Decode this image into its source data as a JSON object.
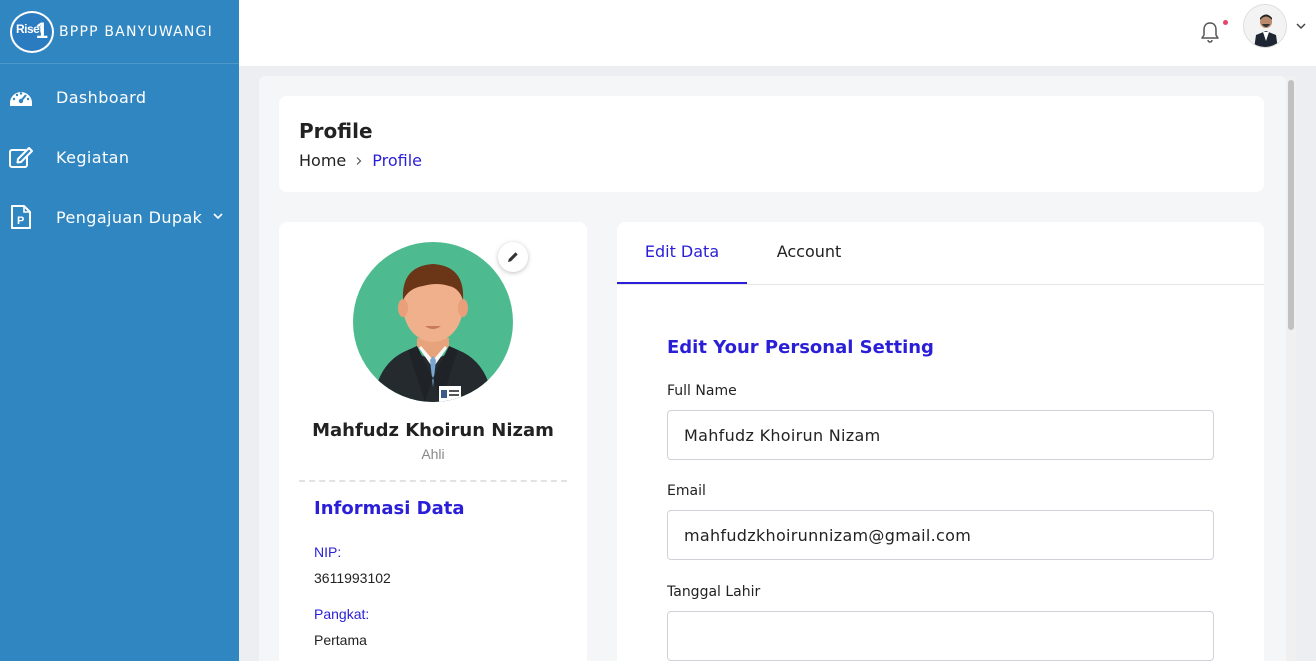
{
  "brand": {
    "name": "BPPP BANYUWANGI",
    "logo_text": "Riset",
    "logo_number": "1"
  },
  "sidebar": {
    "items": [
      {
        "label": "Dashboard",
        "icon": "dashboard-icon"
      },
      {
        "label": "Kegiatan",
        "icon": "edit-icon"
      },
      {
        "label": "Pengajuan Dupak",
        "icon": "document-p-icon",
        "has_submenu": true
      }
    ]
  },
  "topbar": {
    "notification_icon": "bell-icon",
    "has_unread": true,
    "user_menu_icon": "chevron-down-icon"
  },
  "header": {
    "title": "Profile",
    "breadcrumb": [
      "Home",
      "Profile"
    ]
  },
  "profile": {
    "name": "Mahfudz Khoirun Nizam",
    "role": "Ahli",
    "info_title": "Informasi Data",
    "fields": [
      {
        "label": "NIP:",
        "value": "3611993102"
      },
      {
        "label": "Pangkat:",
        "value": "Pertama"
      }
    ]
  },
  "tabs": [
    {
      "label": "Edit Data",
      "active": true
    },
    {
      "label": "Account",
      "active": false
    }
  ],
  "form": {
    "title": "Edit Your Personal Setting",
    "full_name": {
      "label": "Full Name",
      "value": "Mahfudz Khoirun Nizam"
    },
    "email": {
      "label": "Email",
      "value": "mahfudzkhoirunnizam@gmail.com"
    },
    "birth_date": {
      "label": "Tanggal Lahir",
      "value": ""
    }
  },
  "colors": {
    "sidebar": "#2f86c1",
    "accent": "#2a1fd6",
    "avatar_bg": "#4dbb8f"
  }
}
